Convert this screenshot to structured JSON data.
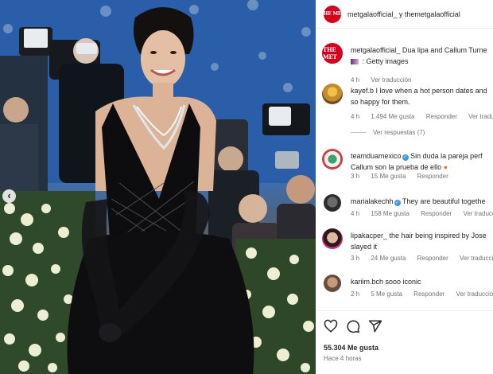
{
  "header": {
    "username": "metgalaofficial_ y themetgalaofficial"
  },
  "caption": {
    "username": "metgalaofficial_",
    "text_line1": "Dua lipa and Callum Turne",
    "text_line2": ": Getty images",
    "time": "4 h",
    "translate": "Ver traducción"
  },
  "comments": [
    {
      "username": "kayef.b",
      "line1": "I love when a hot person dates and",
      "line2": "so happy for them.",
      "time": "4 h",
      "likes": "1.494 Me gusta",
      "reply": "Responder",
      "translate": "Ver traducció"
    },
    {
      "username": "teamduamexico",
      "line1": "Sin duda la pareja perf",
      "line2": "Callum son la prueba de ello",
      "time": "3 h",
      "likes": "15 Me gusta",
      "reply": "Responder",
      "translate": ""
    },
    {
      "username": "marialakechh",
      "line1": "They are beautiful togethe",
      "line2": "",
      "time": "4 h",
      "likes": "158 Me gusta",
      "reply": "Responder",
      "translate": "Ver traducción"
    },
    {
      "username": "lipakacper_",
      "line1": "the hair being inspired by Jose",
      "line2": "slayed it",
      "time": "3 h",
      "likes": "24 Me gusta",
      "reply": "Responder",
      "translate": "Ver traducción"
    },
    {
      "username": "kariim.bch",
      "line1": "sooo iconic",
      "line2": "",
      "time": "2 h",
      "likes": "5 Me gusta",
      "reply": "Responder",
      "translate": "Ver traducción"
    }
  ],
  "replies_link": "Ver respuestas (7)",
  "footer": {
    "likes": "55.304 Me gusta",
    "time": "Hace 4 horas"
  },
  "icons": {
    "like": "heart-icon",
    "comment": "comment-icon",
    "share": "share-icon",
    "prev": "chevron-left-icon"
  },
  "colors": {
    "verified": "#3897f0",
    "brand": "#d6001c"
  }
}
